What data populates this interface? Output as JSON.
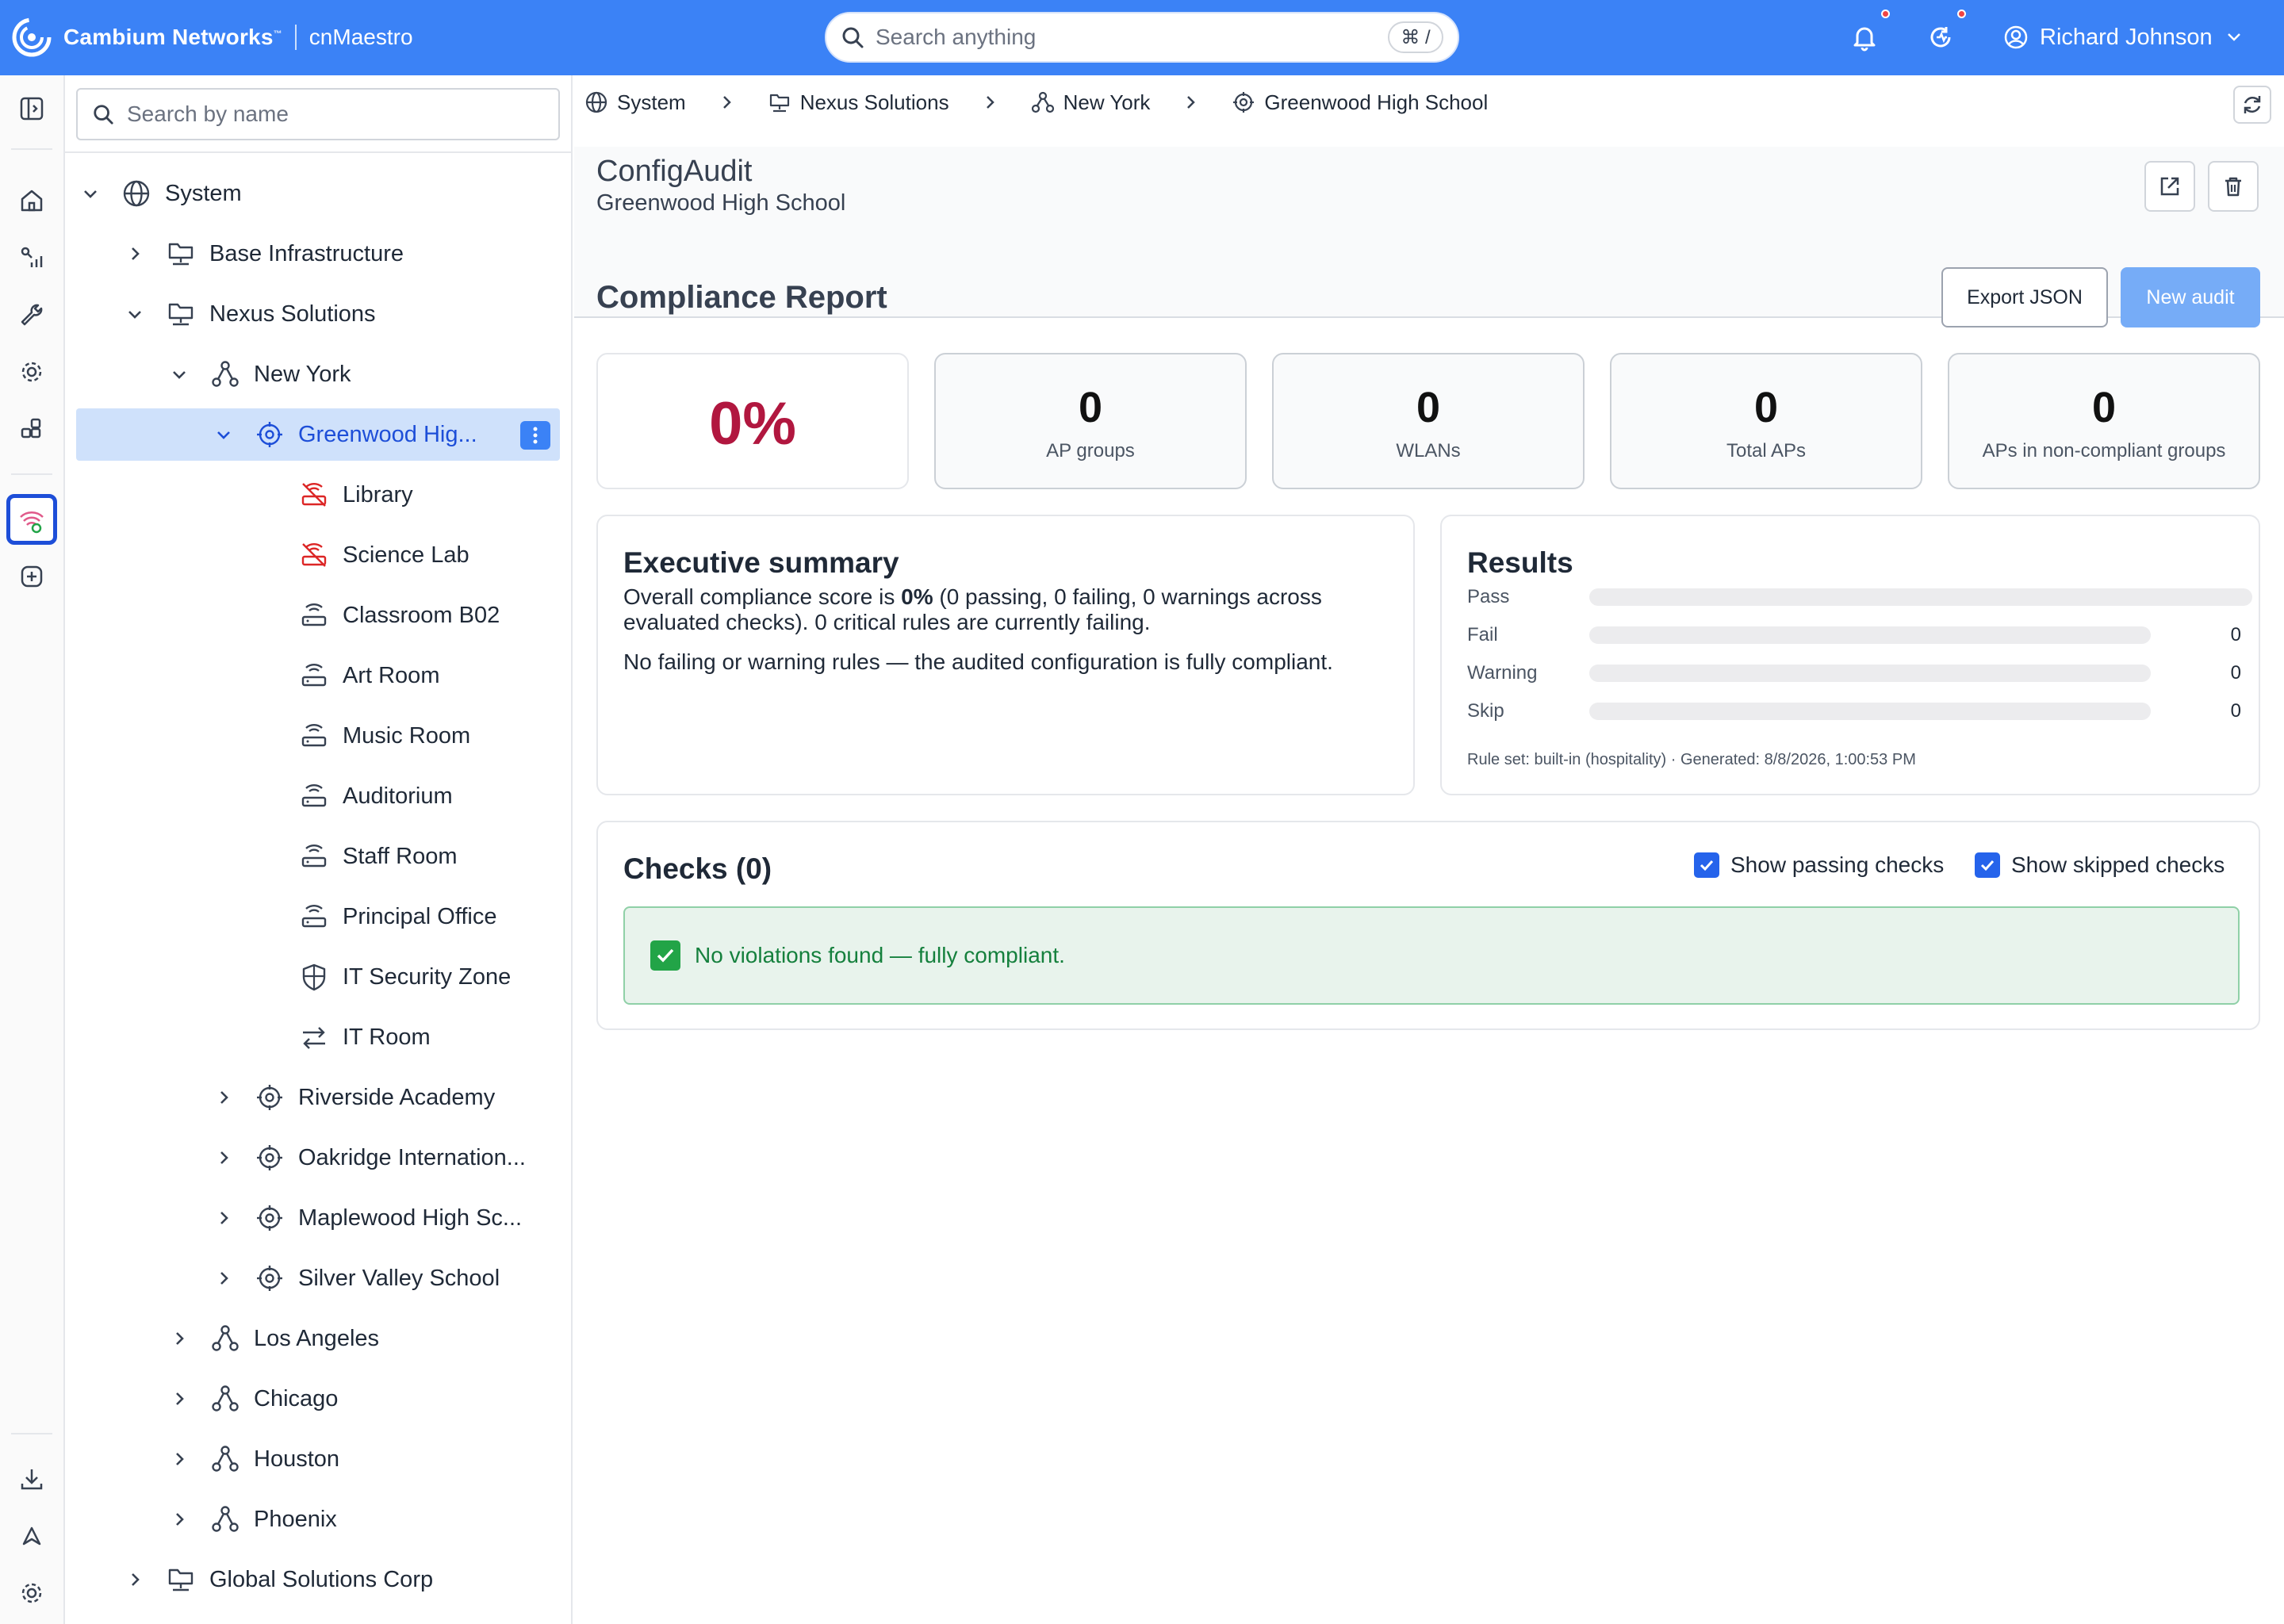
{
  "header": {
    "brand": "Cambium Networks",
    "trademark": "™",
    "product": "cnMaestro",
    "search_placeholder": "Search anything",
    "shortcut": "⌘ /",
    "user_name": "Richard Johnson"
  },
  "tree": {
    "search_placeholder": "Search by name",
    "nodes": [
      {
        "label": "System",
        "icon": "globe-icon",
        "expand": "down"
      },
      {
        "label": "Base Infrastructure",
        "icon": "folder-network-icon",
        "expand": "right"
      },
      {
        "label": "Nexus Solutions",
        "icon": "folder-network-icon",
        "expand": "down"
      },
      {
        "label": "New York",
        "icon": "network-nodes-icon",
        "expand": "down"
      },
      {
        "label": "Greenwood Hig...",
        "icon": "site-target-icon",
        "expand": "down",
        "selected": true
      },
      {
        "label": "Library",
        "icon": "ap-offline-icon",
        "status": "offline"
      },
      {
        "label": "Science Lab",
        "icon": "ap-offline-icon",
        "status": "offline"
      },
      {
        "label": "Classroom B02",
        "icon": "access-point-icon"
      },
      {
        "label": "Art Room",
        "icon": "access-point-icon"
      },
      {
        "label": "Music Room",
        "icon": "access-point-icon"
      },
      {
        "label": "Auditorium",
        "icon": "access-point-icon"
      },
      {
        "label": "Staff Room",
        "icon": "access-point-icon"
      },
      {
        "label": "Principal Office",
        "icon": "access-point-icon"
      },
      {
        "label": "IT Security Zone",
        "icon": "shield-icon"
      },
      {
        "label": "IT Room",
        "icon": "switch-arrows-icon"
      },
      {
        "label": "Riverside Academy",
        "icon": "site-target-icon",
        "expand": "right"
      },
      {
        "label": "Oakridge Internation...",
        "icon": "site-target-icon",
        "expand": "right"
      },
      {
        "label": "Maplewood High Sc...",
        "icon": "site-target-icon",
        "expand": "right"
      },
      {
        "label": "Silver Valley School",
        "icon": "site-target-icon",
        "expand": "right"
      },
      {
        "label": "Los Angeles",
        "icon": "network-nodes-icon",
        "expand": "right"
      },
      {
        "label": "Chicago",
        "icon": "network-nodes-icon",
        "expand": "right"
      },
      {
        "label": "Houston",
        "icon": "network-nodes-icon",
        "expand": "right"
      },
      {
        "label": "Phoenix",
        "icon": "network-nodes-icon",
        "expand": "right"
      },
      {
        "label": "Global Solutions Corp",
        "icon": "folder-network-icon",
        "expand": "right"
      }
    ]
  },
  "breadcrumb": [
    "System",
    "Nexus Solutions",
    "New York",
    "Greenwood High School"
  ],
  "page": {
    "title": "ConfigAudit",
    "subtitle": "Greenwood High School"
  },
  "report": {
    "title": "Compliance Report",
    "export_label": "Export JSON",
    "new_audit_label": "New audit",
    "score": "0%",
    "stats": [
      {
        "value": "0",
        "label": "AP groups"
      },
      {
        "value": "0",
        "label": "WLANs"
      },
      {
        "value": "0",
        "label": "Total APs"
      },
      {
        "value": "0",
        "label": "APs in non-compliant groups"
      }
    ]
  },
  "summary": {
    "title": "Executive summary",
    "line1_pre": "Overall compliance score is ",
    "line1_bold": "0%",
    "line1_post": " (0 passing, 0 failing, 0 warnings across evaluated checks). 0 critical rules are currently failing.",
    "line2": "No failing or warning rules — the audited configuration is fully compliant."
  },
  "results": {
    "title": "Results",
    "rows": [
      {
        "label": "Pass",
        "value": ""
      },
      {
        "label": "Fail",
        "value": "0"
      },
      {
        "label": "Warning",
        "value": "0"
      },
      {
        "label": "Skip",
        "value": "0"
      }
    ],
    "meta": "Rule set: built-in (hospitality) · Generated: 8/8/2026, 1:00:53 PM"
  },
  "checks": {
    "title": "Checks (0)",
    "show_passing": "Show passing checks",
    "show_skipped": "Show skipped checks",
    "empty_message": "No violations found — fully compliant."
  },
  "colors": {
    "topbar": "#3b82f6",
    "score": "#b1173f",
    "selected_row": "#cfe1fb",
    "success_bg": "#e8f3ec",
    "success_text": "#15803d"
  }
}
